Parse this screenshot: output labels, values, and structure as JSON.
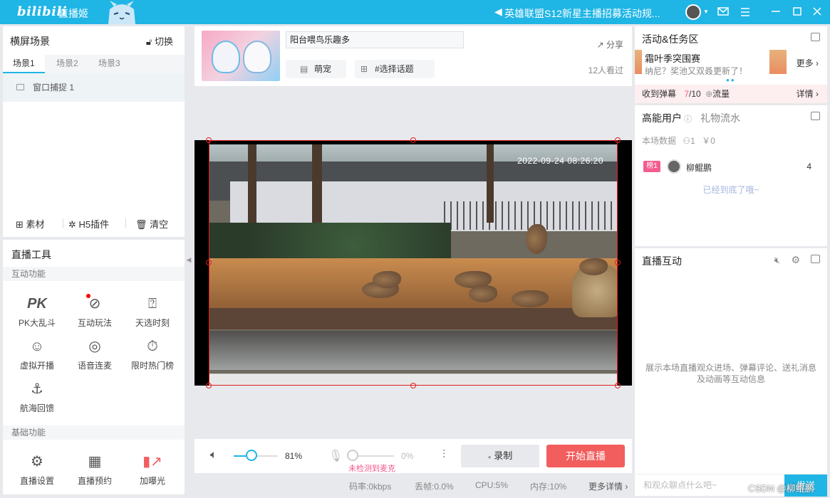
{
  "titlebar": {
    "logo": "bilibili",
    "app_name": "直播姬",
    "announcement": "英雄联盟S12新星主播招募活动规..."
  },
  "scenes": {
    "header": "横屏场景",
    "switch_label": "切换",
    "tabs": [
      "场景1",
      "场景2",
      "场景3"
    ],
    "active_tab": "场景1",
    "source_item": "窗口捕捉 1",
    "actions": [
      "素材",
      "H5插件",
      "清空"
    ]
  },
  "tools": {
    "header": "直播工具",
    "interactive_section": "互动功能",
    "interactive": [
      {
        "label": "PK大乱斗",
        "icon": "pk-icon"
      },
      {
        "label": "互动玩法",
        "icon": "interactive-play-icon"
      },
      {
        "label": "天选时刻",
        "icon": "lucky-draw-icon"
      },
      {
        "label": "虚拟开播",
        "icon": "virtual-avatar-icon"
      },
      {
        "label": "语音连麦",
        "icon": "voice-link-icon"
      },
      {
        "label": "限时热门榜",
        "icon": "hot-rank-icon"
      },
      {
        "label": "航海回馈",
        "icon": "voyage-reward-icon"
      }
    ],
    "basic_section": "基础功能",
    "basic": [
      {
        "label": "直播设置",
        "icon": "settings-gear-icon"
      },
      {
        "label": "直播预约",
        "icon": "calendar-reservation-icon"
      },
      {
        "label": "加曝光",
        "icon": "boost-exposure-icon"
      }
    ]
  },
  "room": {
    "title": "阳台喂鸟乐趣多",
    "category": "萌宠",
    "topic": "#选择话题",
    "share": "分享",
    "viewers": "12人看过"
  },
  "preview": {
    "timestamp": "2022-09-24 08:26:20"
  },
  "controls": {
    "volume_pct": "81%",
    "volume_value": 0.81,
    "mic_pct": "0%",
    "mic_value": 0,
    "mic_warning": "未检测到麦克",
    "record": "录制",
    "start_live": "开始直播"
  },
  "status": {
    "bitrate": "码率:0kbps",
    "dropped": "丢帧:0.0%",
    "cpu": "CPU:5%",
    "memory": "内存:10%",
    "more": "更多详情"
  },
  "activity": {
    "header": "活动&任务区",
    "event_title": "霜叶季突围赛",
    "event_sub": "纳尼？奖池又双叒更新了！",
    "more": "更多",
    "danmu_label": "收到弹幕",
    "danmu_count": "7",
    "danmu_total": "/10",
    "danmu_reward": "流量",
    "details": "详情"
  },
  "users": {
    "tab_active": "高能用户",
    "tab_other": "礼物流水",
    "stats_label": "本场数据",
    "stats_people": "1",
    "stats_money": "￥0",
    "rank_badge": "榜1",
    "user_name": "柳鲲鹏",
    "user_value": "4",
    "end_text": "已经到底了哦~"
  },
  "interaction": {
    "header": "直播互动",
    "empty_text": "展示本场直播观众进场、弹幕评论、送礼消息及动画等互动信息",
    "input_placeholder": "和观众聊点什么吧~",
    "send": "发送"
  },
  "watermark": "CSDN @柳鲲鹏",
  "colors": {
    "accent": "#1fb5e5",
    "live_button": "#f25d5d",
    "pink": "#f25d8e",
    "selection": "#e01e1e"
  }
}
